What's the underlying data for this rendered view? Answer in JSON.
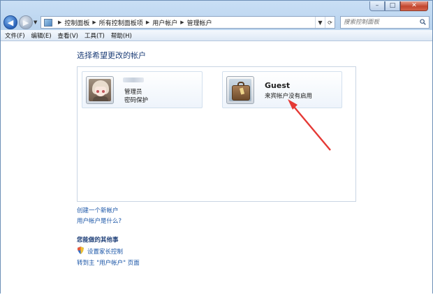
{
  "window": {
    "caption_buttons": {
      "minimize": "–",
      "maximize": "□",
      "close": "✕"
    }
  },
  "address": {
    "breadcrumbs": [
      "控制面板",
      "所有控制面板项",
      "用户帐户",
      "管理帐户"
    ],
    "search_placeholder": "搜索控制面板"
  },
  "menu": [
    "文件(F)",
    "编辑(E)",
    "查看(V)",
    "工具(T)",
    "帮助(H)"
  ],
  "main": {
    "title": "选择希望更改的帐户",
    "accounts": [
      {
        "name": "",
        "role": "管理员",
        "detail": "密码保护",
        "icon": "anime-avatar"
      },
      {
        "name": "Guest",
        "detail": "来宾帐户没有启用",
        "icon": "briefcase-avatar"
      }
    ],
    "links": [
      "创建一个新帐户",
      "用户帐户是什么?"
    ],
    "other_heading": "您能做的其他事",
    "other_links": [
      "设置家长控制",
      "转到主 \"用户帐户\" 页面"
    ]
  },
  "colors": {
    "link": "#1a55a7",
    "heading": "#1e3f78",
    "annotation_arrow": "#e53935"
  }
}
